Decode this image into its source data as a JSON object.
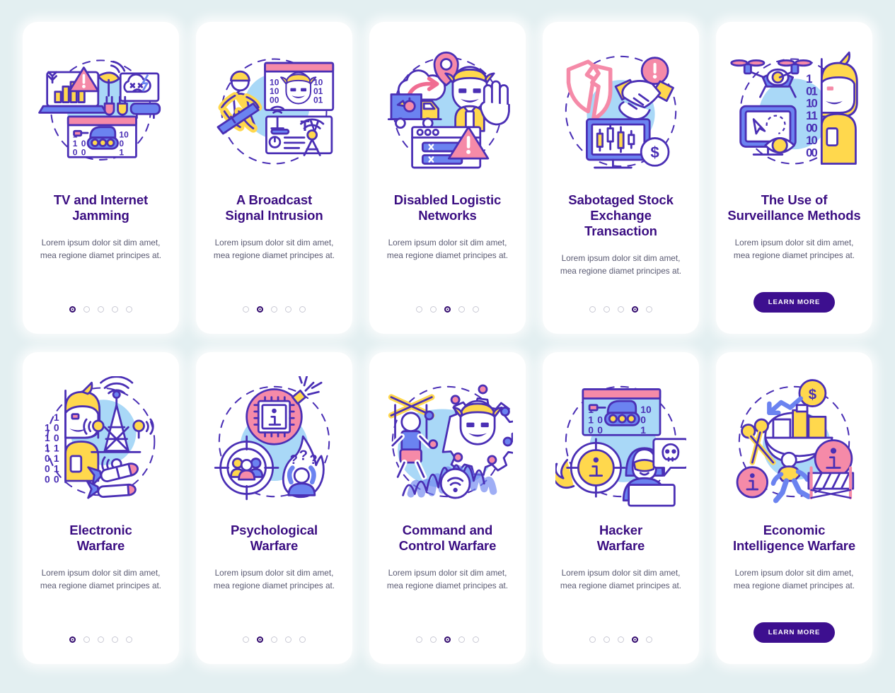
{
  "page": {
    "background_color": "#e3eff1",
    "title_color": "#3b0e82",
    "body_color": "#5a5a72",
    "accent_color": "#3d0f8f",
    "card_background": "#ffffff",
    "dot_active_color": "#320a6e",
    "dot_inactive_color": "#c9c9d4"
  },
  "palette": {
    "outline": "#4a2fb5",
    "outline_dark": "#3d2a8f",
    "blue": "#6b83f0",
    "blue_light": "#8fc4f5",
    "blue_pale": "#a9d8f7",
    "yellow": "#ffd84d",
    "pink": "#f58aa8",
    "pink_deep": "#f06d92",
    "white": "#ffffff"
  },
  "body_text": "Lorem ipsum dolor sit dim amet, mea regione diamet principes at.",
  "learn_more_label": "LEARN MORE",
  "cards": [
    {
      "id": "tv-and-internet-jamming",
      "title": "TV and Internet\nJamming",
      "body": "Lorem ipsum dolor sit dim amet, mea regione diamet principes at.",
      "illustration": "laptop-chart-satellite-tank-binary",
      "dots": {
        "count": 5,
        "active_index": 0
      },
      "footer_type": "dots"
    },
    {
      "id": "a-broadcast-signal-intrusion",
      "title": "A Broadcast\nSignal Intrusion",
      "body": "Lorem ipsum dolor sit dim amet, mea regione diamet principes at.",
      "illustration": "soldier-hacker-tv-antenna",
      "dots": {
        "count": 5,
        "active_index": 1
      },
      "footer_type": "dots"
    },
    {
      "id": "disabled-logistic-networks",
      "title": "Disabled Logistic\nNetworks",
      "body": "Lorem ipsum dolor sit dim amet, mea regione diamet principes at.",
      "illustration": "truck-mappin-hacker-stop-error",
      "dots": {
        "count": 5,
        "active_index": 2
      },
      "footer_type": "dots"
    },
    {
      "id": "sabotaged-stock-exchange-transaction",
      "title": "Sabotaged Stock\nExchange Transaction",
      "body": "Lorem ipsum dolor sit dim amet, mea regione diamet principes at.",
      "illustration": "broken-shield-handshake-stock-monitor",
      "dots": {
        "count": 5,
        "active_index": 3
      },
      "footer_type": "dots"
    },
    {
      "id": "the-use-of-surveillance-methods",
      "title": "The Use of\nSurveillance Methods",
      "body": "Lorem ipsum dolor sit dim amet, mea regione diamet principes at.",
      "illustration": "drone-monitor-eye-binary-hacker",
      "dots": {
        "count": 5,
        "active_index": 4
      },
      "footer_type": "button",
      "button_label": "LEARN MORE"
    },
    {
      "id": "electronic-warfare",
      "title": "Electronic\nWarfare",
      "body": "Lorem ipsum dolor sit dim amet, mea regione diamet principes at.",
      "illustration": "radio-tower-binary-hacker-missiles",
      "dots": {
        "count": 5,
        "active_index": 0
      },
      "footer_type": "dots"
    },
    {
      "id": "psychological-warfare",
      "title": "Psychological\nWarfare",
      "body": "Lorem ipsum dolor sit dim amet, mea regione diamet principes at.",
      "illustration": "info-bomb-crosshair-people-flame",
      "dots": {
        "count": 5,
        "active_index": 1
      },
      "footer_type": "dots"
    },
    {
      "id": "command-and-control-warfare",
      "title": "Command and\nControl Warfare",
      "body": "Lorem ipsum dolor sit dim amet, mea regione diamet principes at.",
      "illustration": "puppet-gear-hacker-wifi-waves",
      "dots": {
        "count": 5,
        "active_index": 2
      },
      "footer_type": "dots"
    },
    {
      "id": "hacker-warfare",
      "title": "Hacker\nWarfare",
      "body": "Lorem ipsum dolor sit dim amet, mea regione diamet principes at.",
      "illustration": "tank-binary-flame-info-hooded-hacker-skull",
      "dots": {
        "count": 5,
        "active_index": 3
      },
      "footer_type": "dots"
    },
    {
      "id": "economic-intelligence-warfare",
      "title": "Economic\nIntelligence Warfare",
      "body": "Lorem ipsum dolor sit dim amet, mea regione diamet principes at.",
      "illustration": "cargo-ship-dollar-scissors-info-barrier",
      "dots": {
        "count": 5,
        "active_index": 4
      },
      "footer_type": "button",
      "button_label": "LEARN MORE"
    }
  ]
}
